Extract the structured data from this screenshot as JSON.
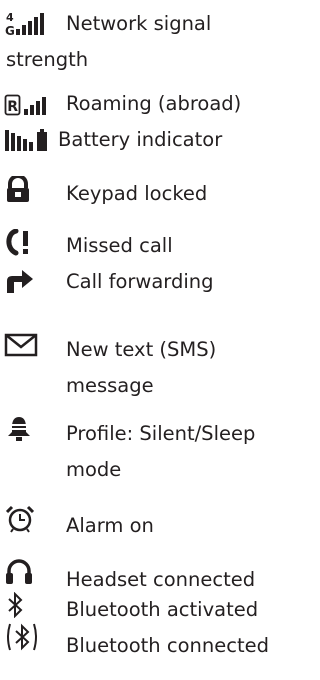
{
  "items": [
    {
      "icon": "network-signal-icon",
      "label": "Network signal strength"
    },
    {
      "icon": "roaming-signal-icon",
      "label": "Roaming (abroad)"
    },
    {
      "icon": "battery-indicator-icon",
      "label": "Battery indicator"
    },
    {
      "icon": "keypad-lock-icon",
      "label": "Keypad locked"
    },
    {
      "icon": "missed-call-icon",
      "label": "Missed call"
    },
    {
      "icon": "call-forwarding-icon",
      "label": "Call forwarding"
    },
    {
      "icon": "envelope-icon",
      "label": "New text (SMS) message"
    },
    {
      "icon": "silent-bell-icon",
      "label": "Profile: Silent/Sleep mode"
    },
    {
      "icon": "alarm-clock-icon",
      "label": "Alarm on"
    },
    {
      "icon": "headset-icon",
      "label": "Headset connected"
    },
    {
      "icon": "bluetooth-icon",
      "label": "Bluetooth activated"
    },
    {
      "icon": "bluetooth-connected-icon",
      "label": "Bluetooth connected"
    }
  ],
  "network_glyph_top": "4",
  "network_glyph_bottom": "G",
  "roaming_glyph": "R"
}
